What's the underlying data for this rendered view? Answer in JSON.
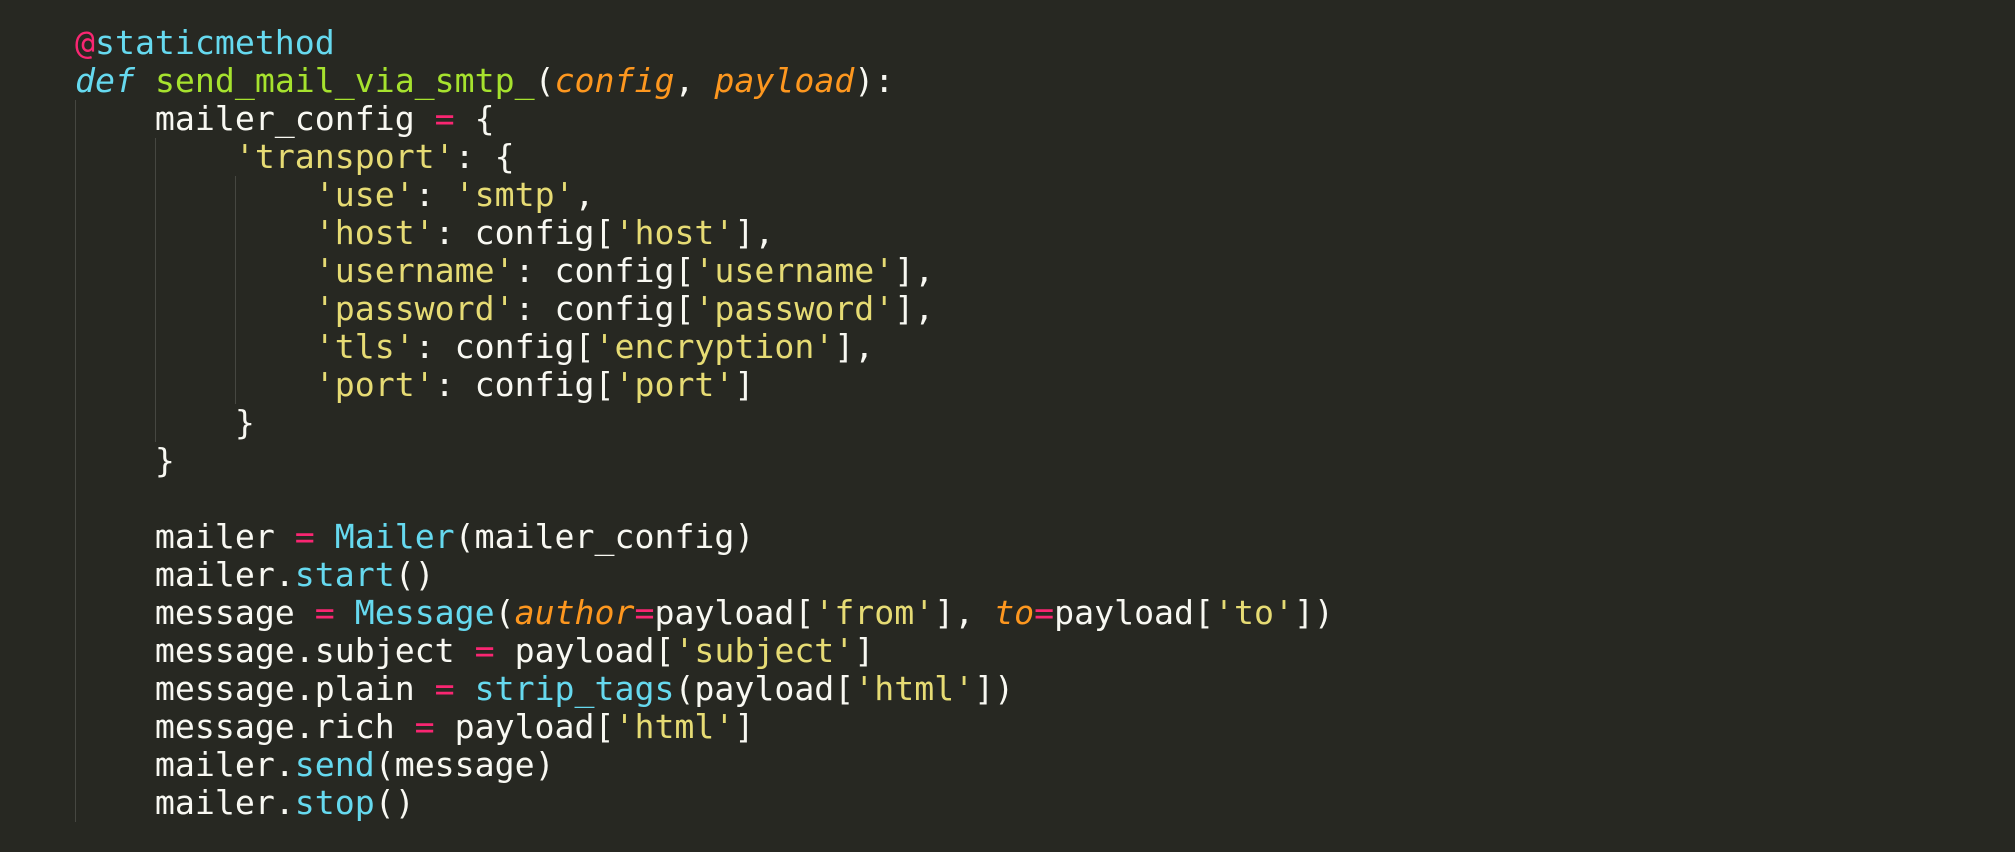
{
  "colors": {
    "background": "#272822",
    "plain": "#F8F8F2",
    "keyword": "#F92672",
    "storage": "#66D9EF",
    "function_name": "#A6E22E",
    "parameter": "#FD971F",
    "string": "#E6DB74",
    "call": "#66D9EF",
    "indent_guide": "#464741"
  },
  "code": {
    "lines": [
      [
        {
          "t": "@",
          "c": "keyword"
        },
        {
          "t": "staticmethod",
          "c": "decor"
        }
      ],
      [
        {
          "t": "def",
          "c": "storage"
        },
        {
          "t": " ",
          "c": "plain"
        },
        {
          "t": "send_mail_via_smtp_",
          "c": "func"
        },
        {
          "t": "(",
          "c": "plain"
        },
        {
          "t": "config",
          "c": "param"
        },
        {
          "t": ", ",
          "c": "plain"
        },
        {
          "t": "payload",
          "c": "param"
        },
        {
          "t": "):",
          "c": "plain"
        }
      ],
      [
        {
          "t": "    mailer_config ",
          "c": "plain"
        },
        {
          "t": "=",
          "c": "keyword"
        },
        {
          "t": " {",
          "c": "plain"
        }
      ],
      [
        {
          "t": "        ",
          "c": "plain"
        },
        {
          "t": "'transport'",
          "c": "string"
        },
        {
          "t": ": {",
          "c": "plain"
        }
      ],
      [
        {
          "t": "            ",
          "c": "plain"
        },
        {
          "t": "'use'",
          "c": "string"
        },
        {
          "t": ": ",
          "c": "plain"
        },
        {
          "t": "'smtp'",
          "c": "string"
        },
        {
          "t": ",",
          "c": "plain"
        }
      ],
      [
        {
          "t": "            ",
          "c": "plain"
        },
        {
          "t": "'host'",
          "c": "string"
        },
        {
          "t": ": config[",
          "c": "plain"
        },
        {
          "t": "'host'",
          "c": "string"
        },
        {
          "t": "],",
          "c": "plain"
        }
      ],
      [
        {
          "t": "            ",
          "c": "plain"
        },
        {
          "t": "'username'",
          "c": "string"
        },
        {
          "t": ": config[",
          "c": "plain"
        },
        {
          "t": "'username'",
          "c": "string"
        },
        {
          "t": "],",
          "c": "plain"
        }
      ],
      [
        {
          "t": "            ",
          "c": "plain"
        },
        {
          "t": "'password'",
          "c": "string"
        },
        {
          "t": ": config[",
          "c": "plain"
        },
        {
          "t": "'password'",
          "c": "string"
        },
        {
          "t": "],",
          "c": "plain"
        }
      ],
      [
        {
          "t": "            ",
          "c": "plain"
        },
        {
          "t": "'tls'",
          "c": "string"
        },
        {
          "t": ": config[",
          "c": "plain"
        },
        {
          "t": "'encryption'",
          "c": "string"
        },
        {
          "t": "],",
          "c": "plain"
        }
      ],
      [
        {
          "t": "            ",
          "c": "plain"
        },
        {
          "t": "'port'",
          "c": "string"
        },
        {
          "t": ": config[",
          "c": "plain"
        },
        {
          "t": "'port'",
          "c": "string"
        },
        {
          "t": "]",
          "c": "plain"
        }
      ],
      [
        {
          "t": "        }",
          "c": "plain"
        }
      ],
      [
        {
          "t": "    }",
          "c": "plain"
        }
      ],
      [
        {
          "t": "",
          "c": "plain"
        }
      ],
      [
        {
          "t": "    mailer ",
          "c": "plain"
        },
        {
          "t": "=",
          "c": "keyword"
        },
        {
          "t": " ",
          "c": "plain"
        },
        {
          "t": "Mailer",
          "c": "call"
        },
        {
          "t": "(mailer_config)",
          "c": "plain"
        }
      ],
      [
        {
          "t": "    mailer.",
          "c": "plain"
        },
        {
          "t": "start",
          "c": "call"
        },
        {
          "t": "()",
          "c": "plain"
        }
      ],
      [
        {
          "t": "    message ",
          "c": "plain"
        },
        {
          "t": "=",
          "c": "keyword"
        },
        {
          "t": " ",
          "c": "plain"
        },
        {
          "t": "Message",
          "c": "call"
        },
        {
          "t": "(",
          "c": "plain"
        },
        {
          "t": "author",
          "c": "param"
        },
        {
          "t": "=",
          "c": "keyword"
        },
        {
          "t": "payload[",
          "c": "plain"
        },
        {
          "t": "'from'",
          "c": "string"
        },
        {
          "t": "], ",
          "c": "plain"
        },
        {
          "t": "to",
          "c": "param"
        },
        {
          "t": "=",
          "c": "keyword"
        },
        {
          "t": "payload[",
          "c": "plain"
        },
        {
          "t": "'to'",
          "c": "string"
        },
        {
          "t": "])",
          "c": "plain"
        }
      ],
      [
        {
          "t": "    message.subject ",
          "c": "plain"
        },
        {
          "t": "=",
          "c": "keyword"
        },
        {
          "t": " payload[",
          "c": "plain"
        },
        {
          "t": "'subject'",
          "c": "string"
        },
        {
          "t": "]",
          "c": "plain"
        }
      ],
      [
        {
          "t": "    message.plain ",
          "c": "plain"
        },
        {
          "t": "=",
          "c": "keyword"
        },
        {
          "t": " ",
          "c": "plain"
        },
        {
          "t": "strip_tags",
          "c": "call"
        },
        {
          "t": "(payload[",
          "c": "plain"
        },
        {
          "t": "'html'",
          "c": "string"
        },
        {
          "t": "])",
          "c": "plain"
        }
      ],
      [
        {
          "t": "    message.rich ",
          "c": "plain"
        },
        {
          "t": "=",
          "c": "keyword"
        },
        {
          "t": " payload[",
          "c": "plain"
        },
        {
          "t": "'html'",
          "c": "string"
        },
        {
          "t": "]",
          "c": "plain"
        }
      ],
      [
        {
          "t": "    mailer.",
          "c": "plain"
        },
        {
          "t": "send",
          "c": "call"
        },
        {
          "t": "(message)",
          "c": "plain"
        }
      ],
      [
        {
          "t": "    mailer.",
          "c": "plain"
        },
        {
          "t": "stop",
          "c": "call"
        },
        {
          "t": "()",
          "c": "plain"
        }
      ]
    ]
  }
}
